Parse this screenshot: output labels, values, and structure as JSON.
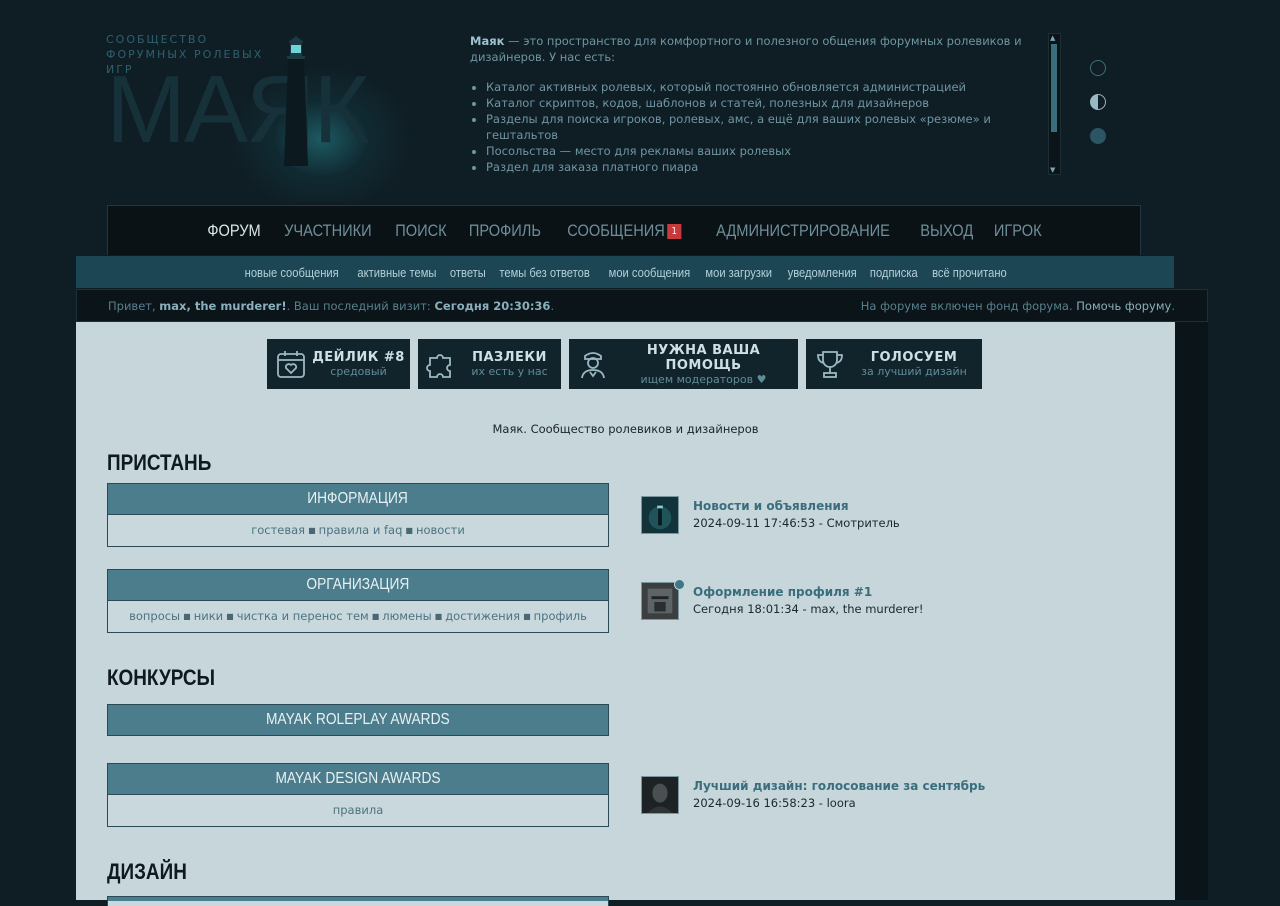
{
  "header": {
    "logo_subtitle": "СООБЩЕСТВО ФОРУМНЫХ РОЛЕВЫХ ИГР",
    "logo_word": "МАЯК",
    "intro_brand": "Маяк",
    "intro_text": " — это пространство для комфортного и полезного общения форумных ролевиков и дизайнеров. У нас есть:",
    "intro_items": [
      "Каталог активных ролевых, который постоянно обновляется администрацией",
      "Каталог скриптов, кодов, шаблонов и статей, полезных для дизайнеров",
      "Разделы для поиска игроков, ролевых, амс, а ещё для ваших ролевых «резюме» и гештальтов",
      "Посольства — место для рекламы ваших ролевых",
      "Раздел для заказа платного пиара"
    ]
  },
  "main_nav": {
    "items": [
      "ФОРУМ",
      "УЧАСТНИКИ",
      "ПОИСК",
      "ПРОФИЛЬ",
      "СООБЩЕНИЯ",
      "АДМИНИСТРИРОВАНИЕ",
      "ВЫХОД",
      "ИГРОК"
    ],
    "messages_badge": "1"
  },
  "sub_nav": {
    "items": [
      "новые сообщения",
      "активные темы",
      "ответы",
      "темы без ответов",
      "мои сообщения",
      "мои загрузки",
      "уведомления",
      "подписка",
      "всё прочитано"
    ]
  },
  "info_bar": {
    "greeting": "Привет, ",
    "username": "max, the murderer!",
    "last_visit_label": ". Ваш последний визит: ",
    "last_visit": "Сегодня 20:30:36",
    "period": ".",
    "fund_text": "На форуме включен фонд форума. ",
    "fund_link": "Помочь форуму",
    "fund_period": "."
  },
  "features": [
    {
      "title": "ДЕЙЛИК #8",
      "subtitle": "средовый",
      "icon": "calendar-heart-icon"
    },
    {
      "title": "ПАЗЛЕКИ",
      "subtitle": "их есть у нас",
      "icon": "puzzle-icon"
    },
    {
      "title": "НУЖНА ВАША ПОМОЩЬ",
      "subtitle": "ищем модераторов ♥",
      "icon": "officer-icon"
    },
    {
      "title": "ГОЛОСУЕМ",
      "subtitle": "за лучший дизайн",
      "icon": "trophy-icon"
    }
  ],
  "site_title": "Маяк. Сообщество ролевиков и дизайнеров",
  "sections": [
    {
      "title": "ПРИСТАНЬ"
    },
    {
      "title": "КОНКУРСЫ"
    },
    {
      "title": "ДИЗАЙН"
    }
  ],
  "forums": {
    "info": {
      "title": "ИНФОРМАЦИЯ",
      "links": [
        "гостевая",
        "правила и faq",
        "новости"
      ]
    },
    "org": {
      "title": "ОРГАНИЗАЦИЯ",
      "links": [
        "вопросы",
        "ники",
        "чистка и перенос тем",
        "люмены",
        "достижения",
        "профиль"
      ]
    },
    "rp_awards": {
      "title": "MAYAK ROLEPLAY AWARDS"
    },
    "design_awards": {
      "title": "MAYAK DESIGN AWARDS",
      "links": [
        "правила"
      ]
    }
  },
  "last_posts": {
    "info": {
      "title": "Новости и объявления",
      "meta": "2024-09-11 17:46:53 - Смотритель"
    },
    "org": {
      "title": "Оформление профиля #1",
      "meta": "Сегодня 18:01:34 - max, the murderer!"
    },
    "design_awards": {
      "title": "Лучший дизайн: голосование за сентябрь",
      "meta": "2024-09-16 16:58:23 - loora"
    }
  },
  "colors": {
    "background": "#0f1d24",
    "content": "#c6d6db",
    "forum_head": "#4c7d8c",
    "badge": "#c7393a"
  }
}
